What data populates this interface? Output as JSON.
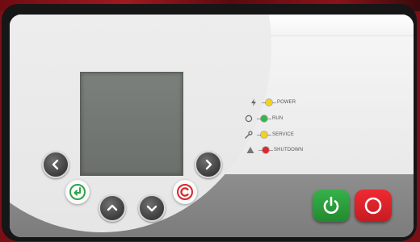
{
  "controller": {
    "indicators": [
      {
        "label": "POWER",
        "symbol": "lightning-icon",
        "color": "#f2d21b"
      },
      {
        "label": "RUN",
        "symbol": "ring-icon",
        "color": "#37b34a"
      },
      {
        "label": "SERVICE",
        "symbol": "wrench-icon",
        "color": "#f2d21b"
      },
      {
        "label": "SHUTDOWN",
        "symbol": "warning-triangle-icon",
        "color": "#e0262b"
      }
    ],
    "keys": {
      "left": "chevron-left-icon",
      "right": "chevron-right-icon",
      "up": "chevron-up-icon",
      "down": "chevron-down-icon",
      "enter": "enter-icon",
      "cancel": "cancel-c-icon"
    },
    "buttons": {
      "start": {
        "icon": "power-icon",
        "color": "#2e9e3e"
      },
      "stop": {
        "icon": "stop-ring-icon",
        "color": "#e2232a"
      }
    }
  }
}
